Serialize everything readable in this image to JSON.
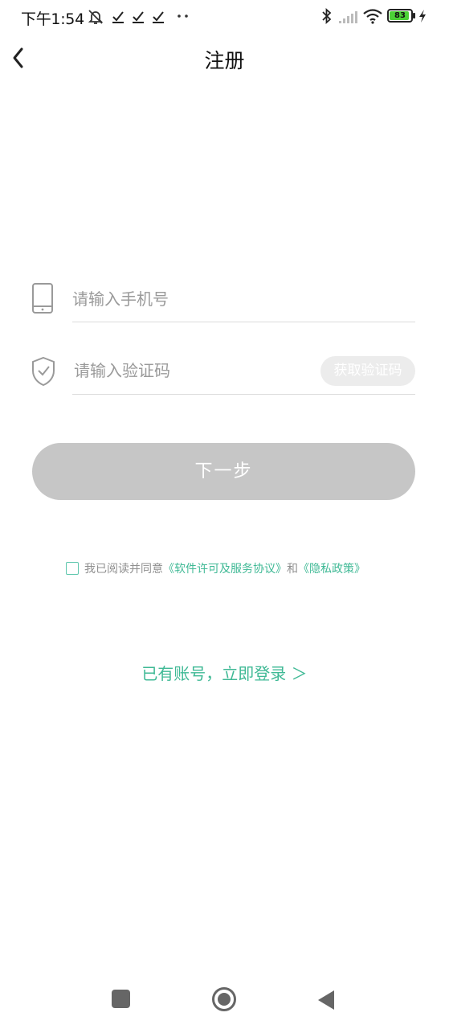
{
  "status_bar": {
    "time": "下午1:54",
    "battery": "83",
    "icons": [
      "notifications-off-icon",
      "checkmark-icon",
      "checkmark-icon",
      "checkmark-icon",
      "more-dots-icon",
      "bluetooth-icon",
      "signal-icon",
      "wifi-icon",
      "battery-icon",
      "charging-icon"
    ]
  },
  "header": {
    "title": "注册",
    "back_icon": "chevron-left-icon"
  },
  "form": {
    "phone_placeholder": "请输入手机号",
    "phone_icon": "phone-icon",
    "code_placeholder": "请输入验证码",
    "code_icon": "shield-check-icon",
    "get_code_label": "获取验证码",
    "next_label": "下一步"
  },
  "agreement": {
    "prefix": "我已阅读并同意",
    "software_link": "《软件许可及服务协议》",
    "conjunction": "和",
    "privacy_link": "《隐私政策》"
  },
  "login_link": "已有账号，立即登录 ＞",
  "colors": {
    "accent": "#3fb995",
    "button_disabled": "#c6c6c6",
    "divider": "#dcdcdc"
  },
  "nav_bar": {
    "icons": [
      "recents-square-icon",
      "home-circle-icon",
      "back-triangle-icon"
    ]
  }
}
